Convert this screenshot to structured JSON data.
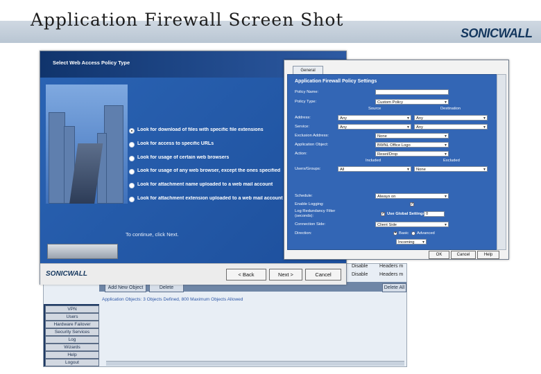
{
  "slide": {
    "title": "Application Firewall Screen Shot",
    "brand": "SONICWALL"
  },
  "wizard": {
    "header_title": "Select Web Access Policy Type",
    "options": [
      {
        "label": "Look for download of files with specific file extensions",
        "selected": true
      },
      {
        "label": "Look for access to specific URLs",
        "selected": false
      },
      {
        "label": "Look for usage of certain web browsers",
        "selected": false
      },
      {
        "label": "Look for usage of any web browser, except the ones specified",
        "selected": false
      },
      {
        "label": "Look for attachment name uploaded to a web mail account",
        "selected": false
      },
      {
        "label": "Look for attachment extension uploaded to a web mail account",
        "selected": false
      }
    ],
    "hint": "To continue, click Next.",
    "logo": "SONICWALL",
    "back_label": "< Back",
    "next_label": "Next >",
    "cancel_label": "Cancel"
  },
  "policy": {
    "tab_label": "General",
    "heading": "Application Firewall Policy Settings",
    "source_header": "Source",
    "destination_header": "Destination",
    "included_header": "Included",
    "excluded_header": "Excluded",
    "fields": {
      "policy_name": {
        "label": "Policy Name:",
        "value": ""
      },
      "policy_type": {
        "label": "Policy Type:",
        "value": "Custom Policy"
      },
      "address": {
        "label": "Address:",
        "source": "Any",
        "destination": "Any"
      },
      "service": {
        "label": "Service:",
        "source": "Any",
        "destination": "Any"
      },
      "exclusion_address": {
        "label": "Exclusion Address:",
        "value": "None"
      },
      "application_object": {
        "label": "Application Object:",
        "value": "BWNL Office Logo"
      },
      "action": {
        "label": "Action:",
        "value": "Reset/Drop"
      },
      "users_groups": {
        "label": "Users/Groups:",
        "included": "All",
        "excluded": "None"
      },
      "schedule": {
        "label": "Schedule:",
        "value": "Always on"
      },
      "enable_logging": {
        "label": "Enable Logging:",
        "checked": true
      },
      "log_redundancy": {
        "label": "Log Redundancy Filter (seconds):",
        "checkbox_label": "Use Global Settings",
        "checked": true,
        "value": "0"
      },
      "connection_side": {
        "label": "Connection Side:",
        "value": "Client Side"
      },
      "direction": {
        "label": "Direction:",
        "basic": "Basic",
        "advanced": "Advanced",
        "value": "Incoming"
      }
    },
    "ok_label": "OK",
    "cancel_label": "Cancel",
    "help_label": "Help"
  },
  "management": {
    "table_rows": [
      {
        "action": "Disable",
        "rule": "Headers m"
      },
      {
        "action": "Disable",
        "rule": "Headers m"
      }
    ],
    "add_button": "Add New Object",
    "delete_button": "Delete",
    "delete_all_button": "Delete All",
    "info_text": "Application Objects: 3 Objects Defined, 800 Maximum Objects Allowed",
    "nav": [
      "VPN",
      "Users",
      "Hardware Failover",
      "Security Services",
      "Log",
      "Wizards",
      "Help",
      "Logout"
    ]
  },
  "colors": {
    "wizard_blue": "#2a63b3",
    "policy_blue": "#3366b5",
    "header_band": "#c3cfdb"
  }
}
